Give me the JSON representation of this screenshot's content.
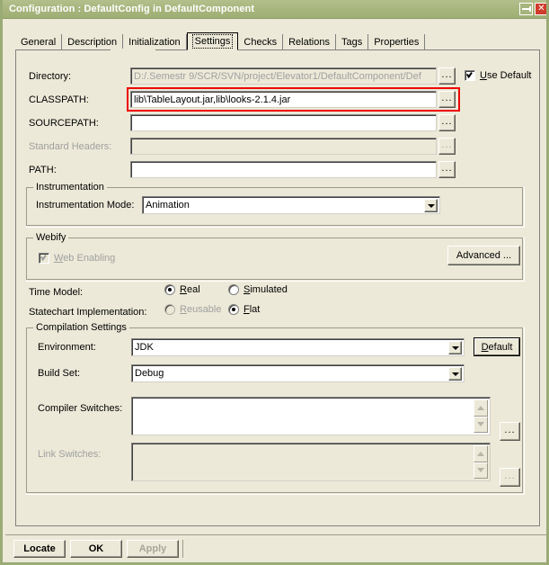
{
  "window": {
    "title": "Configuration : DefaultConfig in DefaultComponent",
    "pin_icon": "pin-icon",
    "close_label": "✕"
  },
  "tabs": [
    {
      "label": "General",
      "selected": false
    },
    {
      "label": "Description",
      "selected": false
    },
    {
      "label": "Initialization",
      "selected": false
    },
    {
      "label": "Settings",
      "selected": true
    },
    {
      "label": "Checks",
      "selected": false
    },
    {
      "label": "Relations",
      "selected": false
    },
    {
      "label": "Tags",
      "selected": false
    },
    {
      "label": "Properties",
      "selected": false
    }
  ],
  "paths": {
    "directory_label": "Directory:",
    "directory_value": "D:/.Semestr 9/SCR/SVN/project/Elevator1/DefaultComponent/Def",
    "classpath_label": "CLASSPATH:",
    "classpath_value": "lib\\TableLayout.jar,lib\\looks-2.1.4.jar",
    "sourcepath_label": "SOURCEPATH:",
    "sourcepath_value": "",
    "standard_headers_label": "Standard Headers:",
    "standard_headers_value": "",
    "path_label": "PATH:",
    "path_value": "",
    "browse_label": "...",
    "use_default_label_mnemonic": "U",
    "use_default_label_rest": "se Default",
    "use_default_checked": true
  },
  "instrumentation": {
    "group_title": "Instrumentation",
    "mode_label": "Instrumentation Mode:",
    "mode_value": "Animation"
  },
  "webify": {
    "group_title": "Webify",
    "web_enabling_mnemonic": "W",
    "web_enabling_rest": "eb Enabling",
    "web_enabling_checked": true,
    "advanced_label": "Advanced ..."
  },
  "models": {
    "time_model_label": "Time Model:",
    "time_real_mnemonic_pre": "R",
    "time_real_mnemonic": "ea",
    "time_real_post": "l",
    "time_real_text": "Real",
    "time_simulated_text": "Simulated",
    "time_selected": "Real",
    "statechart_label": "Statechart Implementation:",
    "statechart_reusable_text": "Reusable",
    "statechart_flat_text": "Flat",
    "statechart_selected": "Flat"
  },
  "compilation": {
    "group_title": "Compilation Settings",
    "environment_label": "Environment:",
    "environment_value": "JDK",
    "default_button_label": "Default",
    "build_set_label": "Build Set:",
    "build_set_value": "Debug",
    "compiler_switches_label": "Compiler Switches:",
    "compiler_switches_value": "",
    "link_switches_label": "Link Switches:",
    "link_switches_value": "",
    "browse_label": "..."
  },
  "buttonbar": {
    "locate_label": "Locate",
    "ok_label": "OK",
    "apply_label": "Apply",
    "apply_enabled": false
  },
  "annotation": {
    "highlight_color": "#ee0000",
    "highlight_target": "classpath-field"
  },
  "colors": {
    "titlebar": "#a9b77f",
    "window_bg": "#ece9d8",
    "close_button": "#cf3c2c",
    "border": "#9aab76"
  }
}
